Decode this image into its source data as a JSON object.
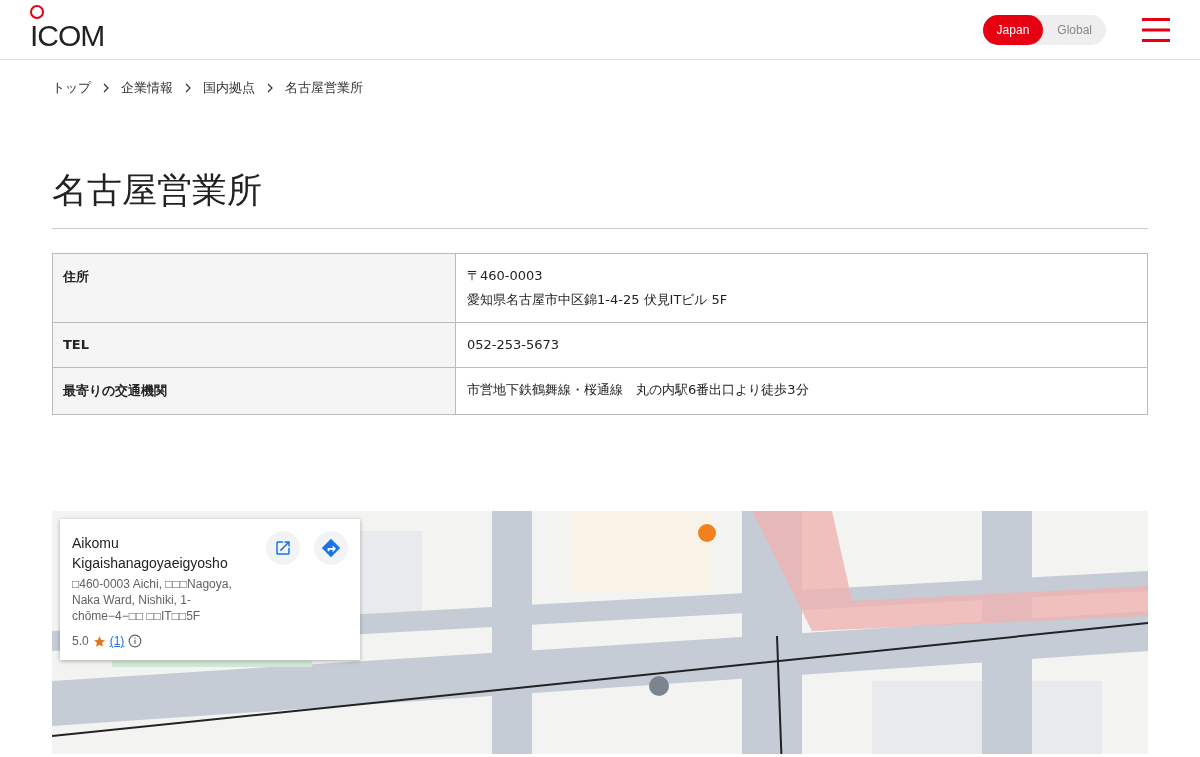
{
  "header": {
    "logo": "ICOM",
    "regions": [
      {
        "label": "Japan",
        "selected": true
      },
      {
        "label": "Global",
        "selected": false
      }
    ]
  },
  "breadcrumb": [
    "トップ",
    "企業情報",
    "国内拠点",
    "名古屋営業所"
  ],
  "title": "名古屋営業所",
  "table": {
    "rows": [
      {
        "label": "住所",
        "lines": [
          "〒460-0003",
          "愛知県名古屋市中区錦1-4-25 伏見ITビル 5F"
        ]
      },
      {
        "label": "TEL",
        "lines": [
          "052-253-5673"
        ]
      },
      {
        "label": "最寄りの交通機関",
        "lines": [
          "市営地下鉄鶴舞線・桜通線　丸の内駅6番出口より徒歩3分"
        ]
      }
    ]
  },
  "map": {
    "kind": "picture",
    "card": {
      "name": "Aikomu Kigaishanagoyaeigyosho",
      "address": "□460-0003 Aichi, □□□Nagoya, Naka Ward, Nishiki, 1-chōme−4−□□ □□IT□□5F",
      "rating": "5.0",
      "reviews": "(1)"
    }
  }
}
